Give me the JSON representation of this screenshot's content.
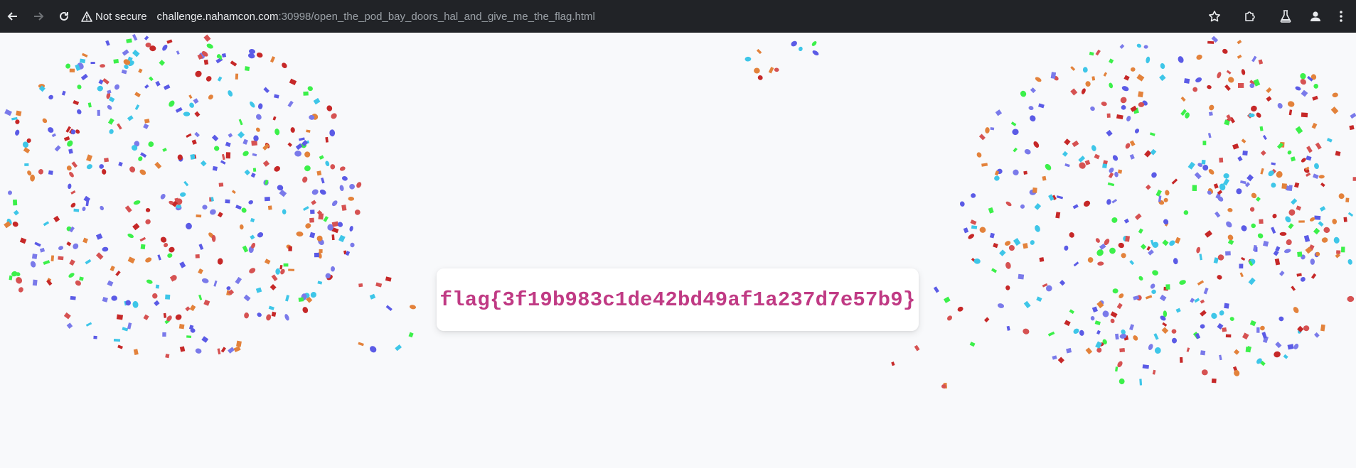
{
  "browser": {
    "security_label": "Not secure",
    "url_host": "challenge.nahamcon.com",
    "url_rest": ":30998/open_the_pod_bay_doors_hal_and_give_me_the_flag.html",
    "icons": {
      "back": "arrow-left-icon",
      "forward": "arrow-right-icon",
      "reload": "reload-icon",
      "warning": "warning-triangle-icon",
      "bookmark": "star-icon",
      "extensions": "puzzle-icon",
      "labs": "flask-icon",
      "profile": "person-icon",
      "menu": "kebab-menu-icon"
    }
  },
  "page": {
    "flag": "flag{3f19b983c1de42bd49af1a237d7e57b9}",
    "confetti_colors": [
      "#c62828",
      "#e3823b",
      "#3ec6e8",
      "#5b5be6",
      "#3cf04a",
      "#7a7aea",
      "#d65252"
    ]
  }
}
